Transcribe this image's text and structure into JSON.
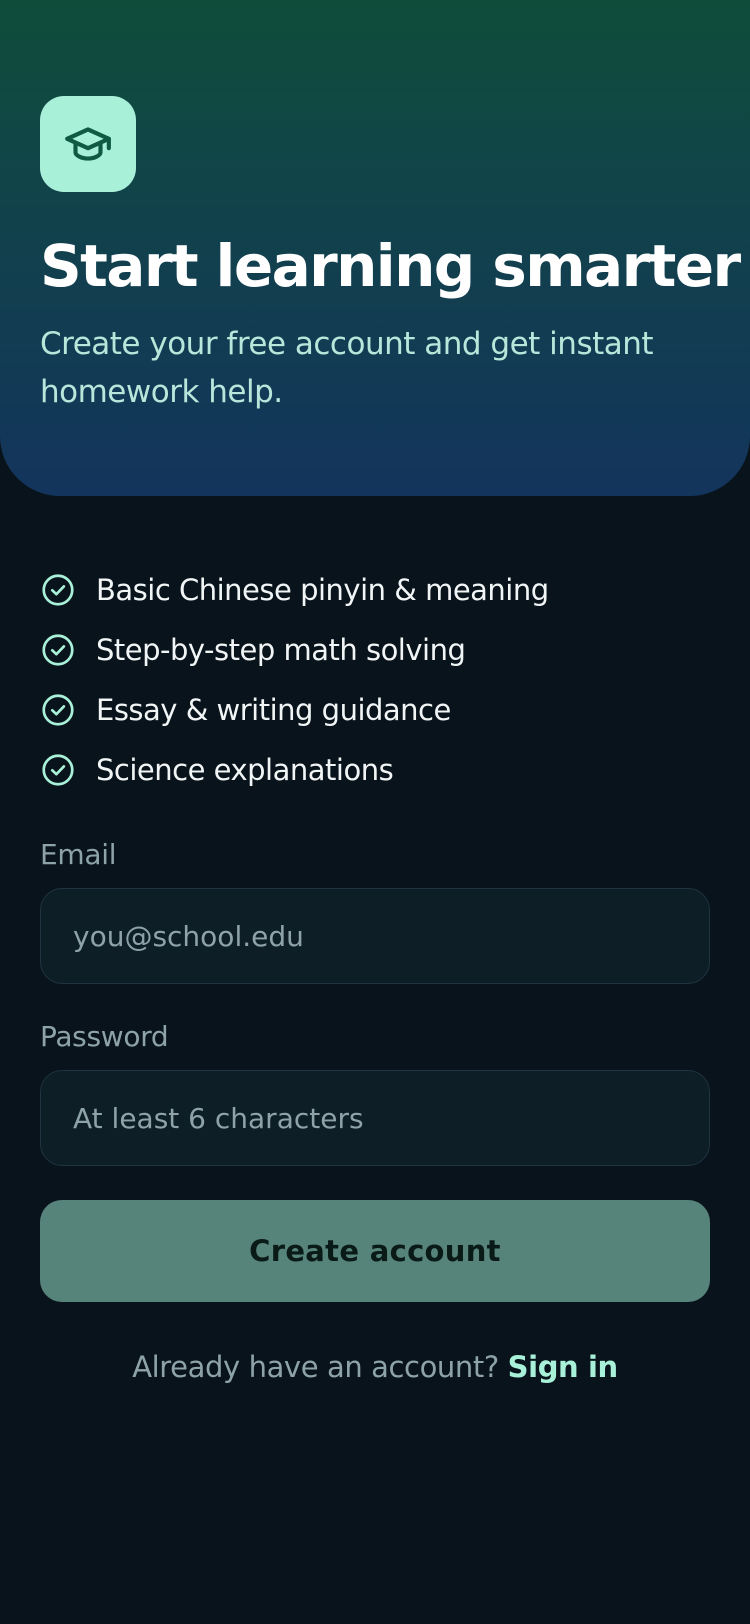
{
  "hero": {
    "title": "Start learning smarter",
    "subtitle": "Create your free account and get instant homework help.",
    "icon": "graduation-cap-icon"
  },
  "features": [
    {
      "label": "Basic Chinese pinyin & meaning",
      "icon": "check-circle-icon"
    },
    {
      "label": "Step-by-step math solving",
      "icon": "check-circle-icon"
    },
    {
      "label": "Essay & writing guidance",
      "icon": "check-circle-icon"
    },
    {
      "label": "Science explanations",
      "icon": "check-circle-icon"
    }
  ],
  "form": {
    "email_label": "Email",
    "email_value": "",
    "email_placeholder": "you@school.edu",
    "password_label": "Password",
    "password_value": "",
    "password_placeholder": "At least 6 characters",
    "submit_label": "Create account"
  },
  "footer": {
    "prompt": "Already have an account?",
    "link": "Sign in"
  },
  "colors": {
    "background": "#08131b",
    "accent": "#a9f0d9",
    "button": "#56837a",
    "hero_gradient_top": "#0f4d3a",
    "hero_gradient_bottom": "#13345c"
  }
}
